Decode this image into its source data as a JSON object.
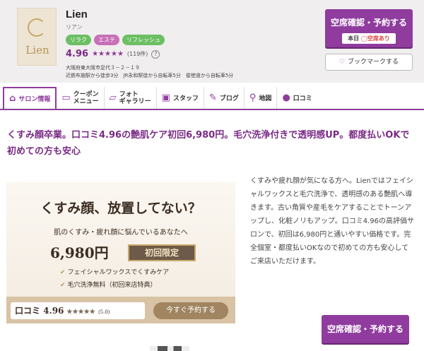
{
  "salon": {
    "logo_text": "Lien",
    "name": "Lien",
    "kana": "リアン",
    "tags": [
      "リラク",
      "エステ",
      "リフレッシュ"
    ],
    "score": "4.96",
    "stars": "★★★★★",
    "review_count": "(119件)",
    "help": "?",
    "address_line1": "大阪府東大阪市足代３－２－１９",
    "address_line2": "近鉄布施駅から徒歩3分　JR永和駅徒から自転車5分　俊徳道から自転車5分"
  },
  "actions": {
    "reserve_label": "空席確認・予約する",
    "today_label": "本日",
    "availability_mark": "◯",
    "availability_status": "空席あり",
    "bookmark_icon": "heart-icon",
    "bookmark_label": "ブックマークする"
  },
  "tabs": [
    {
      "icon": "home-icon",
      "label": "サロン情報"
    },
    {
      "icon": "coupon-icon",
      "label": "クーポン\nメニュー"
    },
    {
      "icon": "photo-icon",
      "label": "フォト\nギャラリー"
    },
    {
      "icon": "staff-icon",
      "label": "スタッフ"
    },
    {
      "icon": "pen-icon",
      "label": "ブログ"
    },
    {
      "icon": "map-pin-icon",
      "label": "地図"
    },
    {
      "icon": "chat-icon",
      "label": "口コミ"
    }
  ],
  "headline": "くすみ顔卒業。口コミ4.96の艶肌ケア初回6,980円。毛穴洗浄付きで透明感UP。都度払いOKで初めての方も安心",
  "banner": {
    "title": "くすみ顔、放置してない？",
    "subtitle": "肌のくすみ・疲れ顔に悩んでいるあなたへ",
    "price": "6,980円",
    "limited": "初回限定",
    "feature1": "フェイシャルワックスでくすみケア",
    "feature2": "毛穴洗浄無料（初回来店特典）",
    "kuchikomi_label": "口コミ 4.96",
    "kuchikomi_stars": "★★★★★",
    "kuchikomi_small": "(5.0)",
    "book_label": "今すぐ予約する"
  },
  "description": "くすみや疲れ顔が気になる方へ。Lienではフェイシャルワックスと毛穴洗浄で、透明感のある艶肌へ導きます。古い角質や産毛をケアすることでトーンアップし、化粧ノリもアップ。口コミ4.96の高評価サロンで、初回は6,980円と通いやすい価格です。完全個室・都度払いOKなので初めての方も安心してご来店いただけます。",
  "colors": {
    "accent": "#8f3c9e",
    "tag_green": "#6cbf63",
    "tag_pink": "#c770b9"
  }
}
